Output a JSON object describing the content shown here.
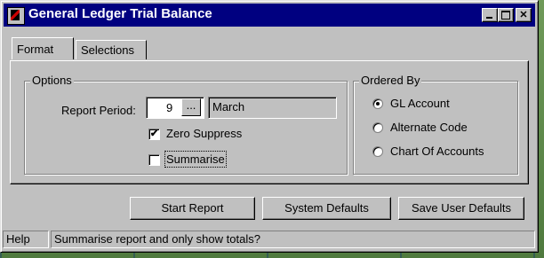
{
  "window": {
    "title": "General Ledger Trial Balance"
  },
  "tabs": [
    {
      "label": "Format"
    },
    {
      "label": "Selections"
    }
  ],
  "options": {
    "legend": "Options",
    "report_period_label": "Report Period:",
    "report_period_value": "9",
    "ellipsis_label": "...",
    "month": "March",
    "zero_suppress": {
      "label": "Zero Suppress",
      "checked": true,
      "mark": "✔"
    },
    "summarise": {
      "label": "Summarise",
      "checked": false
    }
  },
  "ordered_by": {
    "legend": "Ordered By",
    "items": [
      {
        "label": "GL Account",
        "selected": true
      },
      {
        "label": "Alternate Code",
        "selected": false
      },
      {
        "label": "Chart Of Accounts",
        "selected": false
      }
    ]
  },
  "buttons": {
    "start_report": "Start Report",
    "system_defaults": "System Defaults",
    "save_user_defaults": "Save User Defaults"
  },
  "status": {
    "help": "Help",
    "message": "Summarise report and only show totals?"
  }
}
